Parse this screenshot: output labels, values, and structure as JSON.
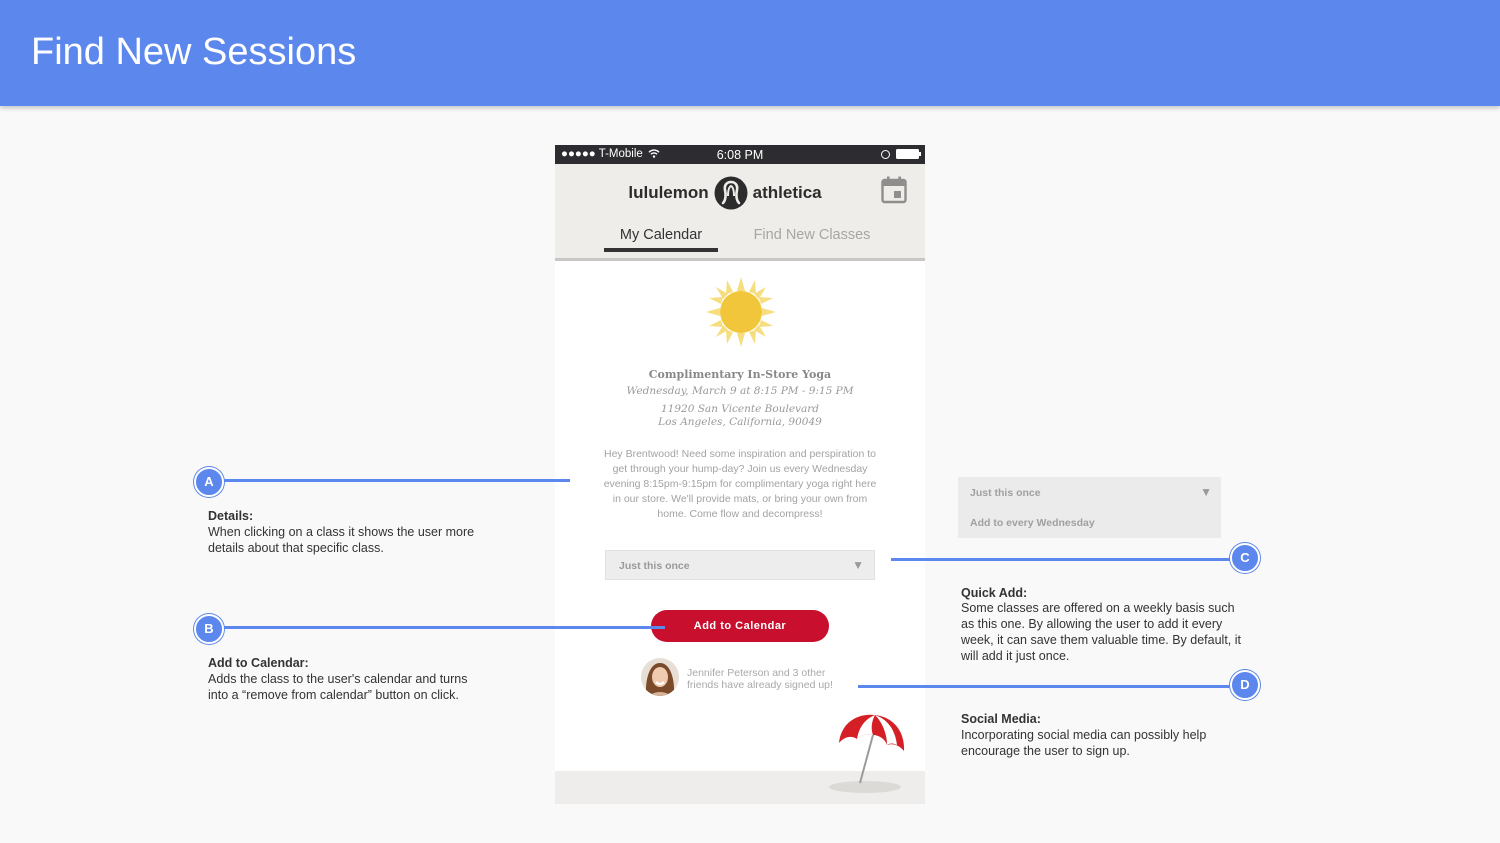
{
  "page": {
    "title": "Find New Sessions"
  },
  "phone": {
    "status": {
      "carrier": "●●●●● T-Mobile",
      "time": "6:08 PM"
    },
    "logo": {
      "left": "lululemon",
      "right": "athletica"
    },
    "tabs": [
      {
        "label": "My Calendar",
        "active": true
      },
      {
        "label": "Find New Classes",
        "active": false
      }
    ],
    "class": {
      "title": "Complimentary In-Store Yoga",
      "datetime": "Wednesday, March 9 at 8:15 PM - 9:15 PM",
      "address_line1": "11920 San Vicente Boulevard",
      "address_line2": "Los Angeles, California, 90049",
      "description": "Hey Brentwood! Need some inspiration and perspiration to get through your hump-day? Join us every Wednesday evening 8:15pm-9:15pm for complimentary yoga right here in our store. We'll provide mats, or bring your own from home. Come flow and decompress!"
    },
    "repeat_select": {
      "value": "Just this once",
      "arrow": "▼"
    },
    "add_button": "Add to Calendar",
    "social": {
      "line1": "Jennifer Peterson and 3 other",
      "line2": "friends have already signed up!"
    }
  },
  "annotations": {
    "a": {
      "badge": "A",
      "title": "Details:",
      "body": "When clicking on a class it shows the user more details about that specific class."
    },
    "b": {
      "badge": "B",
      "title": "Add to Calendar:",
      "body": "Adds the class to the user's calendar and turns into a “remove from calendar” button on click."
    },
    "c": {
      "badge": "C",
      "title": "Quick Add:",
      "body": "Some classes are offered on a weekly basis such as this one. By allowing the user to add it every week, it can save them valuable time. By default, it will add it just once."
    },
    "d": {
      "badge": "D",
      "title": "Social Media:",
      "body": "Incorporating social media can possibly help encourage the user to sign up."
    }
  },
  "expanded_dropdown": {
    "options": [
      "Just this once",
      "Add to every Wednesday"
    ],
    "arrow": "▼"
  },
  "colors": {
    "accent": "#5c87ec",
    "brand_red": "#c8102e",
    "sun": "#f2c63a"
  },
  "icons": [
    "wifi-icon",
    "alarm-icon",
    "battery-icon",
    "calendar-icon",
    "sun-icon",
    "umbrella-icon",
    "avatar"
  ]
}
